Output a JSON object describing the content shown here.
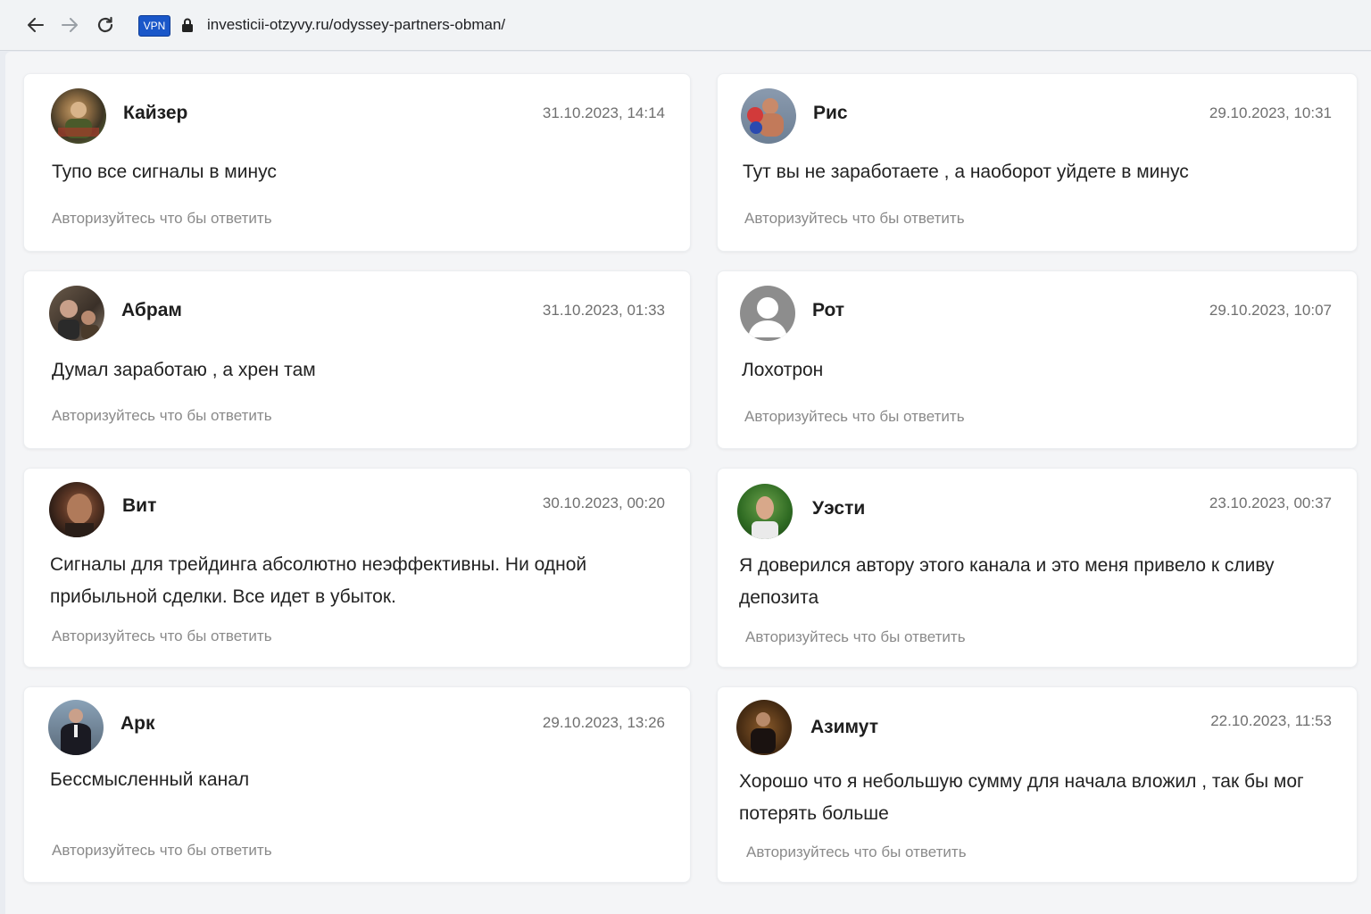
{
  "browser": {
    "url": "investicii-otzyvy.ru/odyssey-partners-obman/",
    "vpn_label": "VPN"
  },
  "comments": [
    {
      "author": "Кайзер",
      "date": "31.10.2023, 14:14",
      "text": "Тупо все сигналы в минус",
      "reply": "Авторизуйтесь что бы ответить",
      "avatar_icon": "photo-avatar"
    },
    {
      "author": "Рис",
      "date": "29.10.2023, 10:31",
      "text": "Тут вы не заработаете , а наоборот уйдете в минус",
      "reply": "Авторизуйтесь что бы ответить",
      "avatar_icon": "photo-avatar"
    },
    {
      "author": "Абрам",
      "date": "31.10.2023, 01:33",
      "text": "Думал заработаю , а хрен там",
      "reply": "Авторизуйтесь что бы ответить",
      "avatar_icon": "photo-avatar"
    },
    {
      "author": "Рот",
      "date": "29.10.2023, 10:07",
      "text": "Лохотрон",
      "reply": "Авторизуйтесь что бы ответить",
      "avatar_icon": "default-user-icon"
    },
    {
      "author": "Вит",
      "date": "30.10.2023, 00:20",
      "text": "Сигналы для трейдинга абсолютно неэффективны. Ни одной прибыльной сделки. Все идет в убыток.",
      "reply": "Авторизуйтесь что бы ответить",
      "avatar_icon": "photo-avatar"
    },
    {
      "author": "Уэсти",
      "date": "23.10.2023, 00:37",
      "text": "Я доверился автору этого канала и это меня привело к сливу депозита",
      "reply": "Авторизуйтесь что бы ответить",
      "avatar_icon": "photo-avatar"
    },
    {
      "author": "Арк",
      "date": "29.10.2023, 13:26",
      "text": "Бессмысленный канал",
      "reply": "Авторизуйтесь что бы ответить",
      "avatar_icon": "photo-avatar"
    },
    {
      "author": "Азимут",
      "date": "22.10.2023, 11:53",
      "text": "Хорошо что я небольшую сумму для начала вложил , так бы мог потерять больше",
      "reply": "Авторизуйтесь что бы ответить",
      "avatar_icon": "photo-avatar"
    }
  ]
}
